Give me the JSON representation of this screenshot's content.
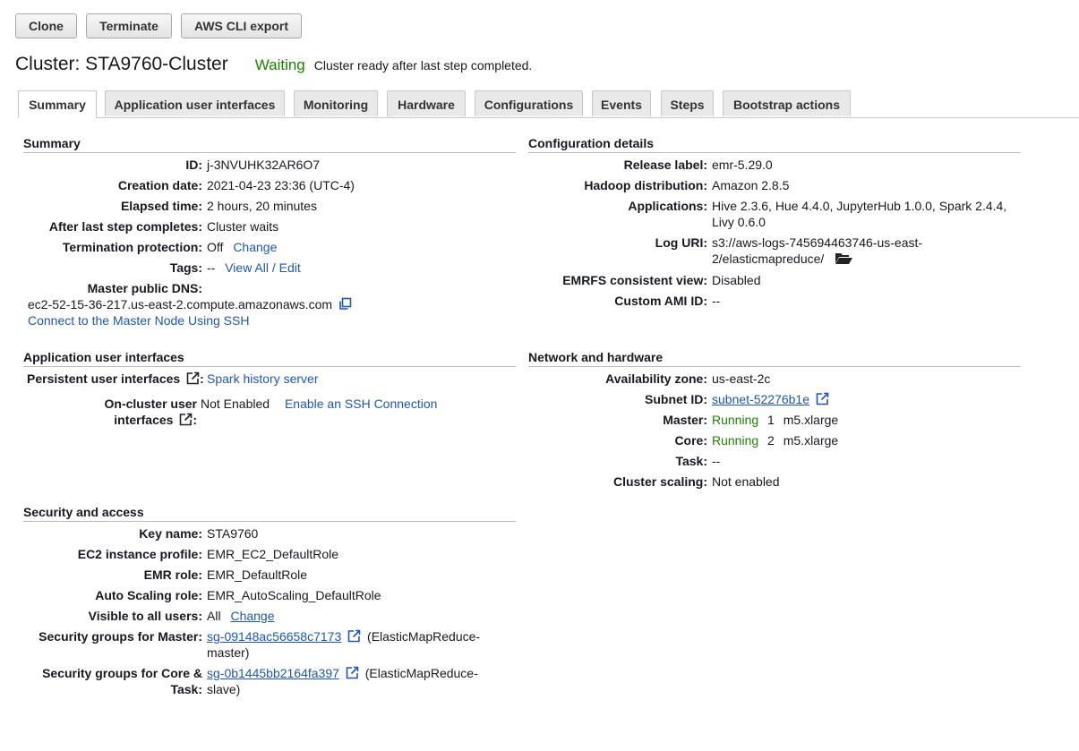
{
  "toolbar": {
    "clone": "Clone",
    "terminate": "Terminate",
    "cli_export": "AWS CLI export"
  },
  "header": {
    "title": "Cluster: STA9760-Cluster",
    "status": "Waiting",
    "status_message": "Cluster ready after last step completed."
  },
  "tabs": [
    "Summary",
    "Application user interfaces",
    "Monitoring",
    "Hardware",
    "Configurations",
    "Events",
    "Steps",
    "Bootstrap actions"
  ],
  "summary": {
    "title": "Summary",
    "id_label": "ID:",
    "id": "j-3NVUHK32AR6O7",
    "creation_label": "Creation date:",
    "creation": "2021-04-23 23:36 (UTC-4)",
    "elapsed_label": "Elapsed time:",
    "elapsed": "2 hours, 20 minutes",
    "after_step_label": "After last step completes:",
    "after_step": "Cluster waits",
    "termination_label": "Termination protection:",
    "termination": "Off",
    "termination_change": "Change",
    "tags_label": "Tags:",
    "tags": "--",
    "tags_link": "View All / Edit",
    "dns_label": "Master public DNS:",
    "dns": "ec2-52-15-36-217.us-east-2.compute.amazonaws.com",
    "ssh_link": "Connect to the Master Node Using SSH"
  },
  "config": {
    "title": "Configuration details",
    "release_label": "Release label:",
    "release": "emr-5.29.0",
    "hadoop_label": "Hadoop distribution:",
    "hadoop": "Amazon 2.8.5",
    "apps_label": "Applications:",
    "apps_line1": "Hive 2.3.6, Hue 4.4.0, JupyterHub 1.0.0, Spark 2.4.4,",
    "apps_line2": "Livy 0.6.0",
    "log_label": "Log URI:",
    "log_line1": "s3://aws-logs-745694463746-us-east-",
    "log_line2": "2/elasticmapreduce/",
    "emrfs_label": "EMRFS consistent view:",
    "emrfs": "Disabled",
    "ami_label": "Custom AMI ID:",
    "ami": "--"
  },
  "app_ui": {
    "title": "Application user interfaces",
    "persistent_label": "Persistent user interfaces",
    "persistent_link": "Spark history server",
    "oncluster_label_1": "On-cluster user",
    "oncluster_label_2": "interfaces",
    "oncluster_value": "Not Enabled",
    "oncluster_link": "Enable an SSH Connection"
  },
  "network": {
    "title": "Network and hardware",
    "az_label": "Availability zone:",
    "az": "us-east-2c",
    "subnet_label": "Subnet ID:",
    "subnet": "subnet-52276b1e",
    "master_label": "Master:",
    "master_status": "Running",
    "master_count": "1",
    "master_type": "m5.xlarge",
    "core_label": "Core:",
    "core_status": "Running",
    "core_count": "2",
    "core_type": "m5.xlarge",
    "task_label": "Task:",
    "task": "--",
    "scaling_label": "Cluster scaling:",
    "scaling": "Not enabled"
  },
  "security": {
    "title": "Security and access",
    "key_label": "Key name:",
    "key": "STA9760",
    "ec2_profile_label": "EC2 instance profile:",
    "ec2_profile": "EMR_EC2_DefaultRole",
    "emr_role_label": "EMR role:",
    "emr_role": "EMR_DefaultRole",
    "autoscale_label": "Auto Scaling role:",
    "autoscale": "EMR_AutoScaling_DefaultRole",
    "visible_label": "Visible to all users:",
    "visible": "All",
    "visible_change": "Change",
    "sg_master_label": "Security groups for Master:",
    "sg_master": "sg-09148ac56658c7173",
    "sg_master_desc_1": "(ElasticMapReduce-",
    "sg_master_desc_2": "master)",
    "sg_core_label_1": "Security groups for Core &",
    "sg_core_label_2": "Task:",
    "sg_core": "sg-0b1445bb2164fa397",
    "sg_core_desc_1": "(ElasticMapReduce-",
    "sg_core_desc_2": "slave)"
  }
}
